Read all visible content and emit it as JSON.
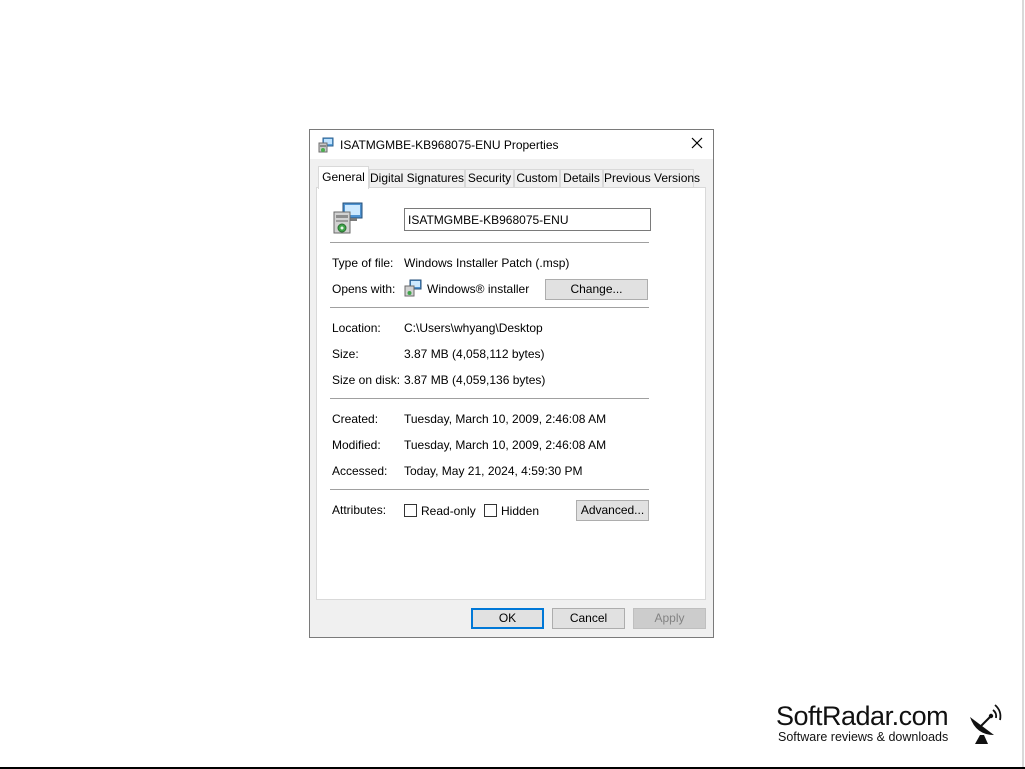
{
  "dialog": {
    "title": "ISATMGMBE-KB968075-ENU Properties",
    "icons": {
      "title": "msp-installer-icon",
      "close": "close-icon"
    }
  },
  "tabs": [
    {
      "label": "General",
      "active": true
    },
    {
      "label": "Digital Signatures",
      "active": false
    },
    {
      "label": "Security",
      "active": false
    },
    {
      "label": "Custom",
      "active": false
    },
    {
      "label": "Details",
      "active": false
    },
    {
      "label": "Previous Versions",
      "active": false
    }
  ],
  "general": {
    "file_name": "ISATMGMBE-KB968075-ENU",
    "type_label": "Type of file:",
    "type_value": "Windows Installer Patch (.msp)",
    "opens_label": "Opens with:",
    "opens_value": "Windows® installer",
    "change_button": "Change...",
    "location_label": "Location:",
    "location_value": "C:\\Users\\whyang\\Desktop",
    "size_label": "Size:",
    "size_value": "3.87 MB (4,058,112 bytes)",
    "size_on_disk_label": "Size on disk:",
    "size_on_disk_value": "3.87 MB (4,059,136 bytes)",
    "created_label": "Created:",
    "created_value": "Tuesday, March 10, 2009, 2:46:08 AM",
    "modified_label": "Modified:",
    "modified_value": "Tuesday, March 10, 2009, 2:46:08 AM",
    "accessed_label": "Accessed:",
    "accessed_value": "Today, May 21, 2024, 4:59:30 PM",
    "attributes_label": "Attributes:",
    "readonly_label": "Read-only",
    "readonly_checked": false,
    "hidden_label": "Hidden",
    "hidden_checked": false,
    "advanced_button": "Advanced..."
  },
  "footer": {
    "ok": "OK",
    "cancel": "Cancel",
    "apply": "Apply"
  },
  "watermark": {
    "title": "SoftRadar.com",
    "subtitle": "Software reviews & downloads",
    "icon": "satellite-dish-icon"
  }
}
